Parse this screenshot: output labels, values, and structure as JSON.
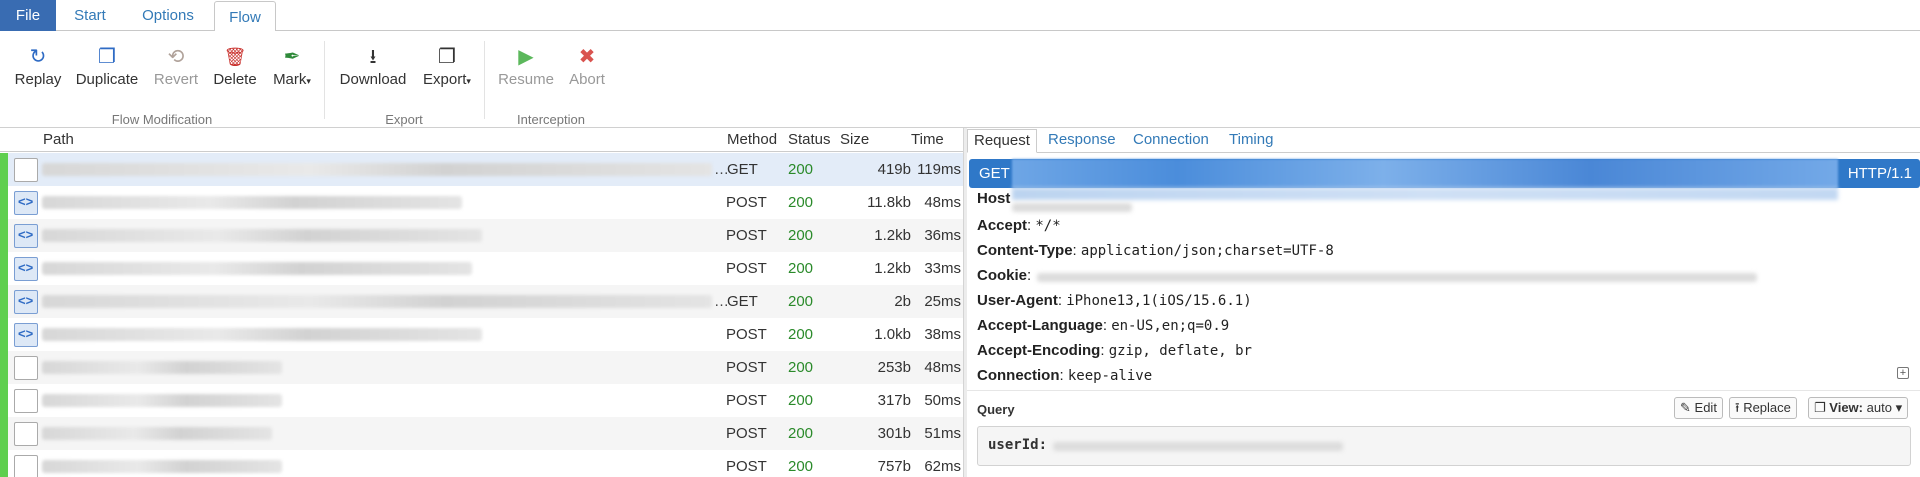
{
  "menu": {
    "file": "File",
    "tabs": [
      "Start",
      "Options",
      "Flow"
    ],
    "active_tab": "Flow"
  },
  "ribbon": {
    "groups": [
      {
        "label": "Flow Modification",
        "buttons": [
          {
            "label": "Replay",
            "icon": "replay-icon",
            "enabled": true
          },
          {
            "label": "Duplicate",
            "icon": "duplicate-icon",
            "enabled": true
          },
          {
            "label": "Revert",
            "icon": "revert-icon",
            "enabled": false
          },
          {
            "label": "Delete",
            "icon": "delete-icon",
            "enabled": true
          },
          {
            "label": "Mark",
            "icon": "mark-icon",
            "enabled": true,
            "dropdown": true
          }
        ]
      },
      {
        "label": "Export",
        "buttons": [
          {
            "label": "Download",
            "icon": "download-icon",
            "enabled": true
          },
          {
            "label": "Export",
            "icon": "export-icon",
            "enabled": true,
            "dropdown": true
          }
        ]
      },
      {
        "label": "Interception",
        "buttons": [
          {
            "label": "Resume",
            "icon": "resume-icon",
            "enabled": false
          },
          {
            "label": "Abort",
            "icon": "abort-icon",
            "enabled": false
          }
        ]
      }
    ]
  },
  "flow_table": {
    "columns": [
      "Path",
      "Method",
      "Status",
      "Size",
      "Time"
    ],
    "rows": [
      {
        "method": "GET",
        "status": "200",
        "size": "419b",
        "time": "119ms",
        "icon": "blank",
        "truncated": true,
        "selected": true
      },
      {
        "method": "POST",
        "status": "200",
        "size": "11.8kb",
        "time": "48ms",
        "icon": "code"
      },
      {
        "method": "POST",
        "status": "200",
        "size": "1.2kb",
        "time": "36ms",
        "icon": "code"
      },
      {
        "method": "POST",
        "status": "200",
        "size": "1.2kb",
        "time": "33ms",
        "icon": "code"
      },
      {
        "method": "GET",
        "status": "200",
        "size": "2b",
        "time": "25ms",
        "icon": "code",
        "truncated": true
      },
      {
        "method": "POST",
        "status": "200",
        "size": "1.0kb",
        "time": "38ms",
        "icon": "code"
      },
      {
        "method": "POST",
        "status": "200",
        "size": "253b",
        "time": "48ms",
        "icon": "blank"
      },
      {
        "method": "POST",
        "status": "200",
        "size": "317b",
        "time": "50ms",
        "icon": "blank"
      },
      {
        "method": "POST",
        "status": "200",
        "size": "301b",
        "time": "51ms",
        "icon": "blank"
      },
      {
        "method": "POST",
        "status": "200",
        "size": "757b",
        "time": "62ms",
        "icon": "blank"
      }
    ]
  },
  "detail": {
    "tabs": [
      "Request",
      "Response",
      "Connection",
      "Timing"
    ],
    "active_tab": "Request",
    "request_line": {
      "method": "GET",
      "version": "HTTP/1.1"
    },
    "headers": [
      {
        "name": "Host",
        "value": ""
      },
      {
        "name": "Accept",
        "value": "*/*"
      },
      {
        "name": "Content-Type",
        "value": "application/json;charset=UTF-8"
      },
      {
        "name": "Cookie",
        "value": ""
      },
      {
        "name": "User-Agent",
        "value": "iPhone13,1(iOS/15.6.1)"
      },
      {
        "name": "Accept-Language",
        "value": "en-US,en;q=0.9"
      },
      {
        "name": "Accept-Encoding",
        "value": "gzip, deflate, br"
      },
      {
        "name": "Connection",
        "value": "keep-alive"
      }
    ],
    "query": {
      "title": "Query",
      "edit": "Edit",
      "replace": "Replace",
      "view": "View:",
      "view_value": "auto",
      "param": "userId:"
    }
  },
  "colors": {
    "accent": "#337ab7",
    "file_bg": "#396cb2",
    "request_bar": "#2f78c8",
    "status_ok": "#2a8a2a",
    "row_marker": "#5fcf4f"
  }
}
